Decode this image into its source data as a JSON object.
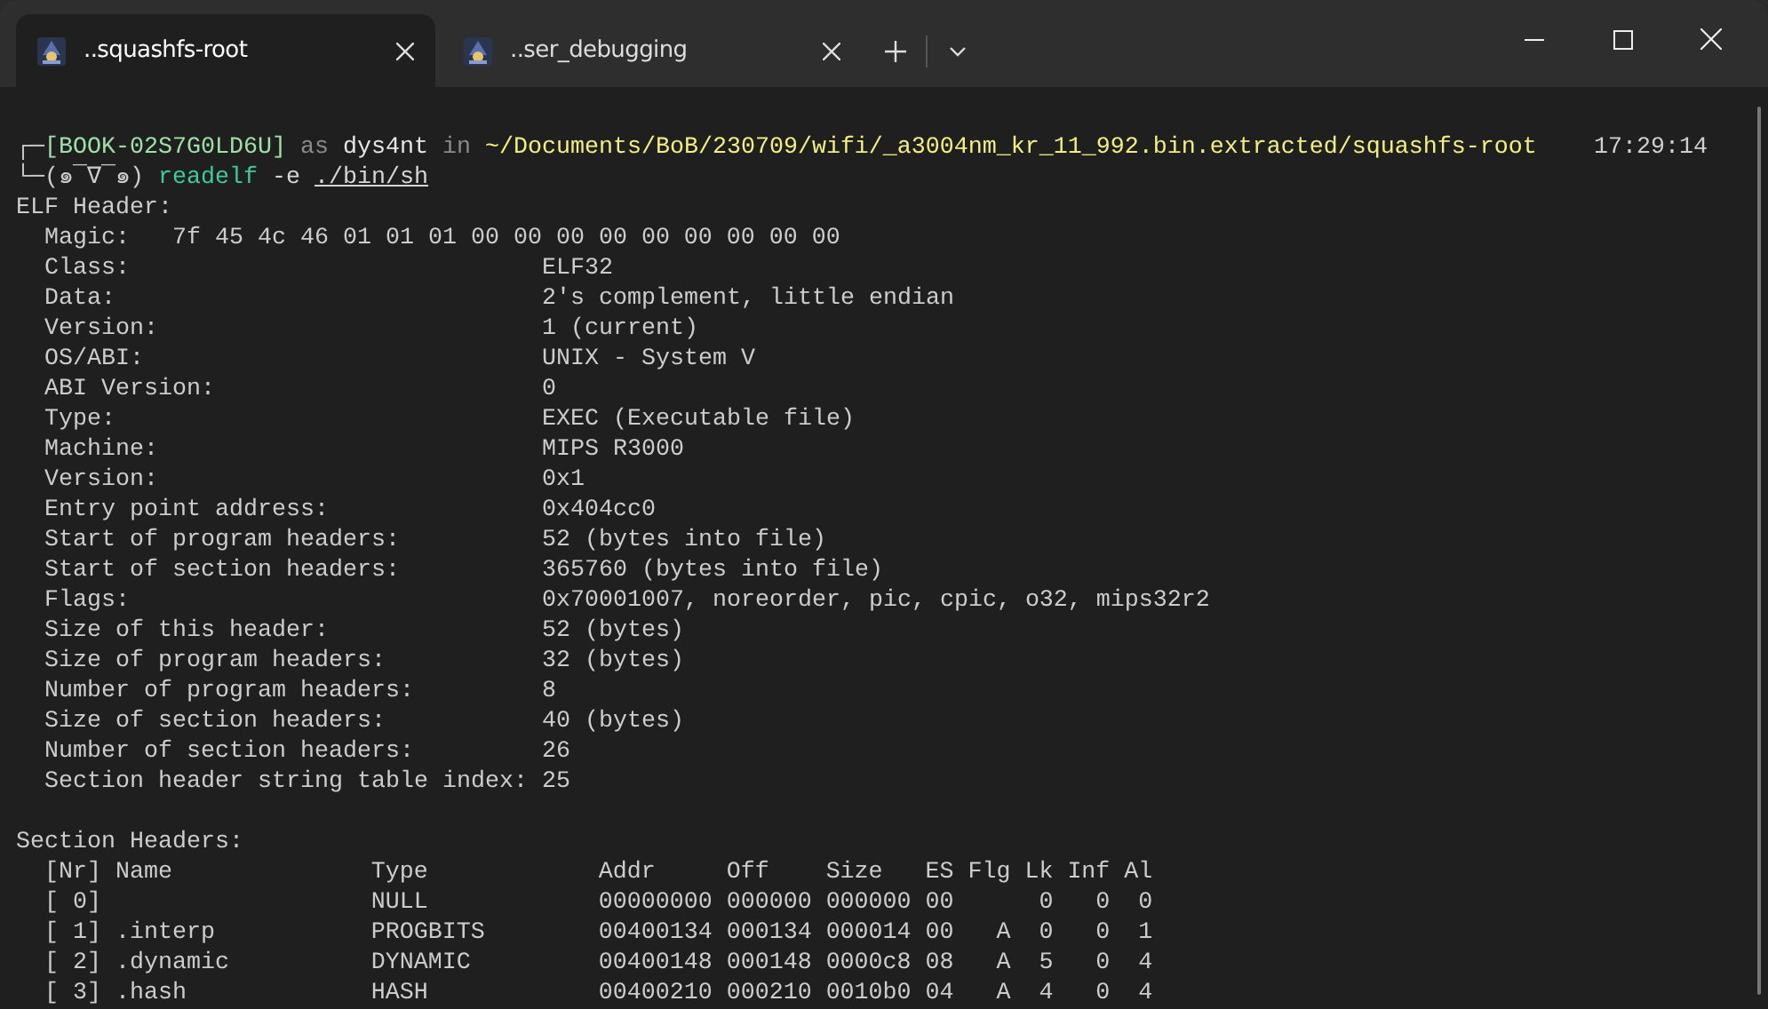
{
  "tabs": [
    {
      "label": "..squashfs-root",
      "selected": true
    },
    {
      "label": "..ser_debugging",
      "selected": false
    }
  ],
  "prompt": {
    "line1": [
      {
        "kind": "frame",
        "text": "┌─"
      },
      {
        "kind": "host",
        "text": "[BOOK-02S7G0LD6U]"
      },
      {
        "kind": "dim",
        "text": " as "
      },
      {
        "kind": "user",
        "text": "dys4nt"
      },
      {
        "kind": "dim",
        "text": " in "
      },
      {
        "kind": "path",
        "text": "~/Documents/BoB/230709/wifi/_a3004nm_kr_11_992.bin.extracted/squashfs-root"
      }
    ],
    "time": "17:29:14",
    "line2": [
      {
        "kind": "frame",
        "text": "└─(๑¯∇¯๑) "
      },
      {
        "kind": "command",
        "text": "readelf"
      },
      {
        "kind": "arg",
        "text": " -e "
      },
      {
        "kind": "file",
        "text": "./bin/sh"
      }
    ]
  },
  "elf_header": {
    "title": "ELF Header:",
    "magic": {
      "label": "Magic:",
      "value": "7f 45 4c 46 01 01 01 00 00 00 00 00 00 00 00 00"
    },
    "fields": [
      {
        "label": "Class:",
        "value": "ELF32"
      },
      {
        "label": "Data:",
        "value": "2's complement, little endian"
      },
      {
        "label": "Version:",
        "value": "1 (current)"
      },
      {
        "label": "OS/ABI:",
        "value": "UNIX - System V"
      },
      {
        "label": "ABI Version:",
        "value": "0"
      },
      {
        "label": "Type:",
        "value": "EXEC (Executable file)"
      },
      {
        "label": "Machine:",
        "value": "MIPS R3000"
      },
      {
        "label": "Version:",
        "value": "0x1"
      },
      {
        "label": "Entry point address:",
        "value": "0x404cc0"
      },
      {
        "label": "Start of program headers:",
        "value": "52 (bytes into file)"
      },
      {
        "label": "Start of section headers:",
        "value": "365760 (bytes into file)"
      },
      {
        "label": "Flags:",
        "value": "0x70001007, noreorder, pic, cpic, o32, mips32r2"
      },
      {
        "label": "Size of this header:",
        "value": "52 (bytes)"
      },
      {
        "label": "Size of program headers:",
        "value": "32 (bytes)"
      },
      {
        "label": "Number of program headers:",
        "value": "8"
      },
      {
        "label": "Size of section headers:",
        "value": "40 (bytes)"
      },
      {
        "label": "Number of section headers:",
        "value": "26"
      },
      {
        "label": "Section header string table index:",
        "value": "25"
      }
    ]
  },
  "section_headers": {
    "title": "Section Headers:",
    "columns": [
      "[Nr]",
      "Name",
      "Type",
      "Addr",
      "Off",
      "Size",
      "ES",
      "Flg",
      "Lk",
      "Inf",
      "Al"
    ],
    "rows": [
      [
        "[ 0]",
        null,
        "NULL",
        "00000000",
        "000000",
        "000000",
        "00",
        null,
        "0",
        "0",
        "0"
      ],
      [
        "[ 1]",
        ".interp",
        "PROGBITS",
        "00400134",
        "000134",
        "000014",
        "00",
        "A",
        "0",
        "0",
        "1"
      ],
      [
        "[ 2]",
        ".dynamic",
        "DYNAMIC",
        "00400148",
        "000148",
        "0000c8",
        "08",
        "A",
        "5",
        "0",
        "4"
      ],
      [
        "[ 3]",
        ".hash",
        "HASH",
        "00400210",
        "000210",
        "0010b0",
        "04",
        "A",
        "4",
        "0",
        "4"
      ]
    ]
  }
}
